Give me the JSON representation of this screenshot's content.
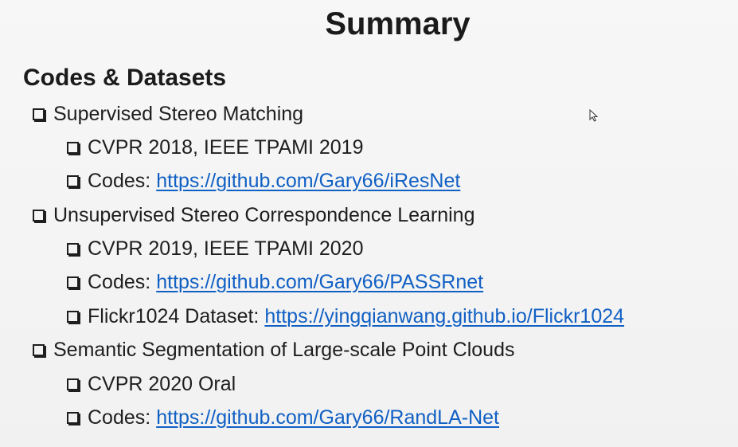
{
  "slide": {
    "title": "Summary",
    "section_heading": "Codes & Datasets",
    "items": [
      {
        "level": 1,
        "text": "Supervised Stereo Matching"
      },
      {
        "level": 2,
        "text": "CVPR 2018, IEEE TPAMI 2019"
      },
      {
        "level": 2,
        "prefix": "Codes:",
        "link": "https://github.com/Gary66/iResNet"
      },
      {
        "level": 1,
        "text": "Unsupervised Stereo Correspondence Learning"
      },
      {
        "level": 2,
        "text": "CVPR 2019, IEEE TPAMI 2020"
      },
      {
        "level": 2,
        "prefix": "Codes:",
        "link": "https://github.com/Gary66/PASSRnet"
      },
      {
        "level": 2,
        "prefix": "Flickr1024 Dataset:",
        "link": "https://yingqianwang.github.io/Flickr1024"
      },
      {
        "level": 1,
        "text": "Semantic Segmentation of Large-scale Point Clouds"
      },
      {
        "level": 2,
        "text": "CVPR 2020 Oral"
      },
      {
        "level": 2,
        "prefix": "Codes:",
        "link": "https://github.com/Gary66/RandLA-Net"
      }
    ]
  },
  "colors": {
    "background": "#f5f5f5",
    "text": "#1e1e1e",
    "link": "#1160c4"
  },
  "icons": {
    "bullet": "checkbox-bullet-icon",
    "cursor": "mouse-pointer-icon"
  }
}
